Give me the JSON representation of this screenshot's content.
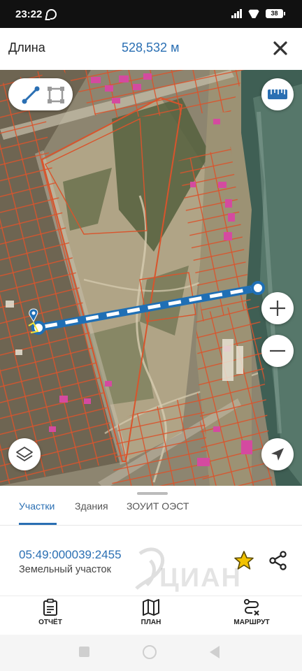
{
  "status_bar": {
    "time": "23:22",
    "battery": "38",
    "icons": [
      "whatsapp-icon",
      "signal-icon",
      "wifi-icon",
      "battery-icon"
    ]
  },
  "header": {
    "title": "Длина",
    "value": "528,532 м",
    "close_icon": "close-icon"
  },
  "map": {
    "measure_line": {
      "label_mode": "line",
      "area_mode": "polygon"
    },
    "icons": [
      "measure-line-icon",
      "measure-area-icon",
      "ruler-icon",
      "zoom-in-icon",
      "zoom-out-icon",
      "layers-icon",
      "locate-icon",
      "pin-icon"
    ]
  },
  "tabs": {
    "items": [
      {
        "label": "Участки",
        "active": true
      },
      {
        "label": "Здания",
        "active": false
      },
      {
        "label": "ЗОУИТ ОЭСТ",
        "active": false
      }
    ]
  },
  "parcel": {
    "cadastral_number": "05:49:000039:2455",
    "type": "Земельный участок",
    "watermark": "ЦИАН"
  },
  "actions": {
    "report_label": "ОТЧЁТ",
    "plan_label": "ПЛАН",
    "route_label": "МАРШРУТ"
  },
  "colors": {
    "accent": "#2a6fb3",
    "parcel_outline": "#d9542c",
    "measure_line": "#1f6fb5",
    "star": "#f2c200"
  }
}
